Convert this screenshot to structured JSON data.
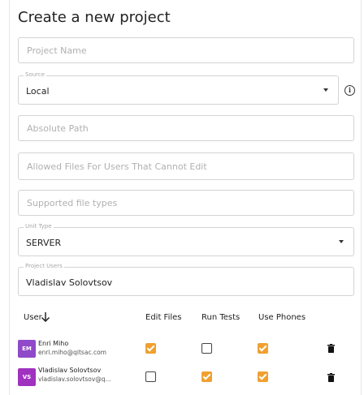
{
  "form": {
    "title": "Create a new project",
    "project_name_placeholder": "Project Name",
    "source": {
      "label": "Source",
      "value": "Local"
    },
    "absolute_path_placeholder": "Absolute Path",
    "allowed_files_placeholder": "Allowed Files For Users That Cannot Edit",
    "supported_types_placeholder": "Supported file types",
    "unit_type": {
      "label": "Unit Type",
      "value": "SERVER"
    },
    "project_users": {
      "label": "Project Users",
      "value": "Vladislav Solovtsov"
    }
  },
  "table": {
    "headers": {
      "user": "User",
      "edit_files": "Edit Files",
      "run_tests": "Run Tests",
      "use_phones": "Use Phones"
    },
    "rows": [
      {
        "initials": "EM",
        "name": "Enri Miho",
        "email": "enri.miho@qitsac.com",
        "avatar_color": "#8f49c9",
        "edit_files": true,
        "run_tests": false,
        "use_phones": true
      },
      {
        "initials": "VS",
        "name": "Vladislav Solovtsov",
        "email": "vladislav.solovtsov@q...",
        "avatar_color": "#a032c0",
        "edit_files": false,
        "run_tests": true,
        "use_phones": true
      }
    ]
  },
  "colors": {
    "accent": "#f0a030",
    "border": "#d3d3d3"
  }
}
